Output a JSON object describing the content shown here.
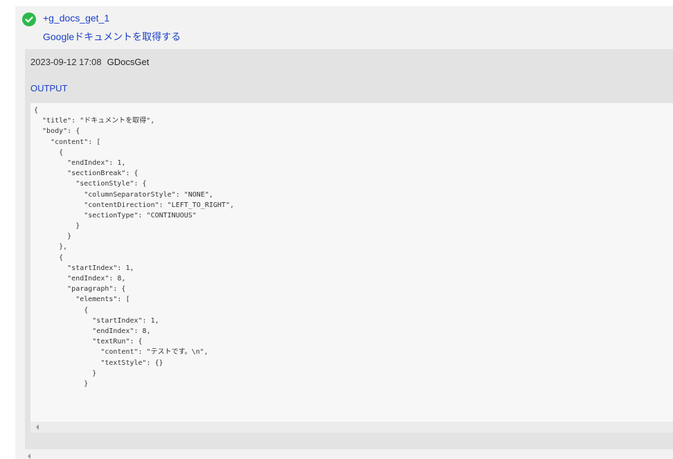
{
  "step": {
    "id": "+g_docs_get_1",
    "description": "Googleドキュメントを取得する",
    "status_icon": "check-circle-icon",
    "status_color": "#2eb84a",
    "link_color": "#1a3ec8"
  },
  "log": {
    "timestamp": "2023-09-12 17:08",
    "tool": "GDocsGet",
    "output_label": "OUTPUT",
    "output_lines": [
      "{",
      "  \"title\": \"ドキュメントを取得\",",
      "  \"body\": {",
      "    \"content\": [",
      "      {",
      "        \"endIndex\": 1,",
      "        \"sectionBreak\": {",
      "          \"sectionStyle\": {",
      "            \"columnSeparatorStyle\": \"NONE\",",
      "            \"contentDirection\": \"LEFT_TO_RIGHT\",",
      "            \"sectionType\": \"CONTINUOUS\"",
      "          }",
      "        }",
      "      },",
      "      {",
      "        \"startIndex\": 1,",
      "        \"endIndex\": 8,",
      "        \"paragraph\": {",
      "          \"elements\": [",
      "            {",
      "              \"startIndex\": 1,",
      "              \"endIndex\": 8,",
      "              \"textRun\": {",
      "                \"content\": \"テストです。\\n\",",
      "                \"textStyle\": {}",
      "              }",
      "            }"
    ]
  }
}
